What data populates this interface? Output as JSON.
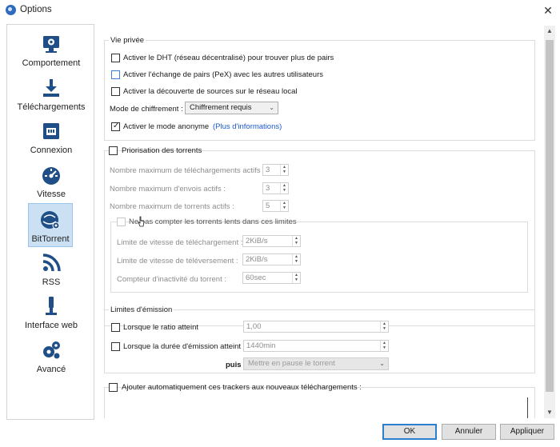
{
  "window": {
    "title": "Options",
    "close_glyph": "✕"
  },
  "sidebar": {
    "items": [
      {
        "label": "Comportement",
        "icon": "behavior-icon"
      },
      {
        "label": "Téléchargements",
        "icon": "download-icon"
      },
      {
        "label": "Connexion",
        "icon": "network-icon"
      },
      {
        "label": "Vitesse",
        "icon": "speedometer-icon"
      },
      {
        "label": "BitTorrent",
        "icon": "bittorrent-icon",
        "selected": true
      },
      {
        "label": "RSS",
        "icon": "rss-icon"
      },
      {
        "label": "Interface web",
        "icon": "web-ui-icon"
      },
      {
        "label": "Avancé",
        "icon": "gears-icon"
      }
    ]
  },
  "privacy": {
    "title": "Vie privée",
    "dht": "Activer le DHT (réseau décentralisé) pour trouver plus de pairs",
    "pex": "Activer l'échange de pairs (PeX) avec les autres utilisateurs",
    "lsd": "Activer la découverte de sources sur le réseau local",
    "encryption_label": "Mode de chiffrement :",
    "encryption_value": "Chiffrement requis",
    "anonymous": "Activer le mode anonyme",
    "more_info": "(Plus d'informations)"
  },
  "queueing": {
    "title": "Priorisation des torrents",
    "max_downloads_label": "Nombre maximum de téléchargements actifs :",
    "max_downloads": "3",
    "max_uploads_label": "Nombre maximum d'envois actifs :",
    "max_uploads": "3",
    "max_torrents_label": "Nombre maximum de torrents actifs :",
    "max_torrents": "5",
    "slow_title": "Ne pas compter les torrents lents dans ces limites",
    "dl_rate_label": "Limite de vitesse de téléchargement :",
    "dl_rate": "2KiB/s",
    "ul_rate_label": "Limite de vitesse de téléversement :",
    "ul_rate": "2KiB/s",
    "inactivity_label": "Compteur d'inactivité du torrent :",
    "inactivity": "60sec"
  },
  "seeding": {
    "title": "Limites d'émission",
    "ratio_label": "Lorsque le ratio atteint",
    "ratio_value": "1,00",
    "time_label": "Lorsque la durée d'émission atteint",
    "time_value": "1440min",
    "then_label": "puis",
    "then_value": "Mettre en pause le torrent"
  },
  "trackers": {
    "label": "Ajouter automatiquement ces trackers aux nouveaux téléchargements :"
  },
  "buttons": {
    "ok": "OK",
    "cancel": "Annuler",
    "apply": "Appliquer"
  },
  "colors": {
    "accent": "#2d7fd0",
    "selection": "#cce0f4",
    "link": "#1a58d4",
    "icon": "#1f4f86"
  }
}
